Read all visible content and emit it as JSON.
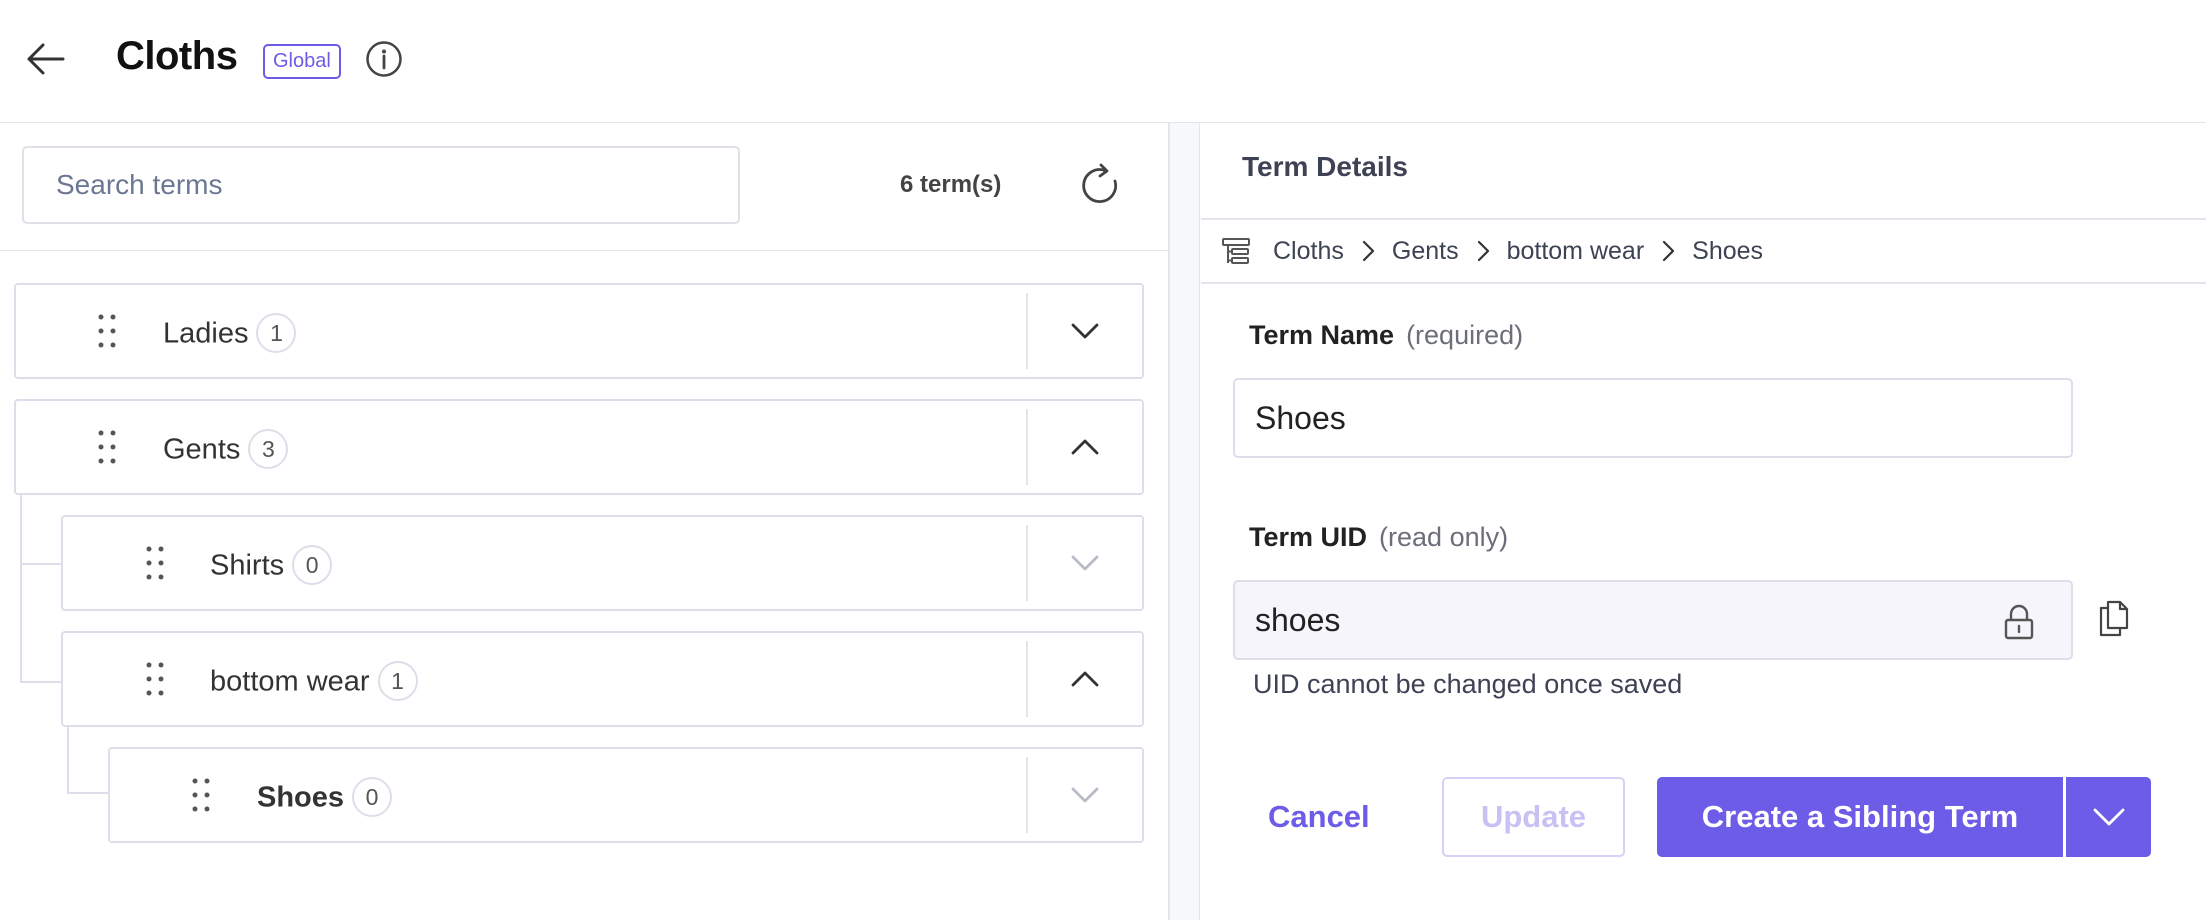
{
  "header": {
    "title": "Cloths",
    "badge": "Global",
    "back_icon": "arrow-left-icon",
    "info_icon": "info-icon"
  },
  "left": {
    "search_placeholder": "Search terms",
    "term_count": "6 term(s)",
    "refresh_icon": "refresh-icon",
    "terms": [
      {
        "label": "Ladies",
        "count": "1",
        "expanded": false
      },
      {
        "label": "Gents",
        "count": "3",
        "expanded": true
      },
      {
        "label": "Shirts",
        "count": "0",
        "expanded": false
      },
      {
        "label": "bottom wear",
        "count": "1",
        "expanded": true
      },
      {
        "label": "Shoes",
        "count": "0",
        "expanded": false,
        "selected": true
      }
    ]
  },
  "details": {
    "title": "Term Details",
    "breadcrumb": [
      "Cloths",
      "Gents",
      "bottom wear",
      "Shoes"
    ],
    "term_name_label": "Term Name",
    "term_name_hint": "(required)",
    "term_name_value": "Shoes",
    "term_uid_label": "Term UID",
    "term_uid_hint": "(read only)",
    "term_uid_value": "shoes",
    "uid_helper": "UID cannot be changed once saved",
    "cancel_label": "Cancel",
    "update_label": "Update",
    "create_label": "Create a Sibling Term"
  },
  "colors": {
    "accent": "#6c5ce7",
    "border": "#dcdfe9",
    "disabled_text": "#c9c1f3"
  }
}
